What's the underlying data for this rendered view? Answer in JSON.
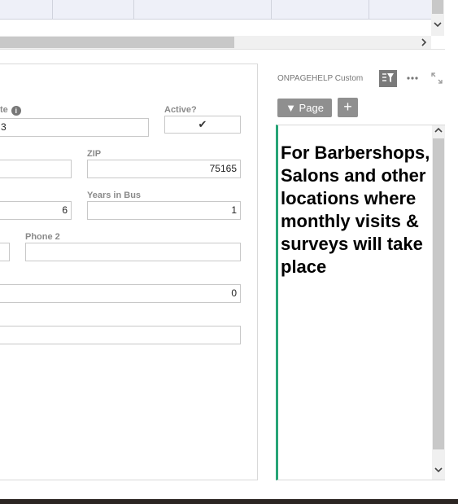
{
  "top_grid": {
    "scroll_down_icon": "chevron-down-icon",
    "scroll_right_icon": "chevron-right-icon"
  },
  "form_panel": {
    "toolbar_icons": [
      "filter-list-icon",
      "more-horizontal-icon",
      "expand-icon"
    ],
    "fields": {
      "date": {
        "label": "te",
        "value": "3"
      },
      "active": {
        "label": "Active?",
        "checked": true,
        "check_glyph": "✔"
      },
      "field_row2_left": {
        "value": ""
      },
      "zip": {
        "label": "ZIP",
        "value": "75165"
      },
      "field_row3_left": {
        "value": "6"
      },
      "years_in_bus": {
        "label": "Years in Bus",
        "value": "1"
      },
      "field_row4_left": {
        "value": ""
      },
      "phone2": {
        "label": "Phone 2",
        "value": ""
      },
      "field_row5": {
        "value": "0"
      },
      "field_row6": {
        "value": ""
      }
    },
    "info_glyph": "i"
  },
  "help_panel": {
    "title": "ONPAGEHELP Custom",
    "page_button": "▼ Page",
    "add_button": "+",
    "help_text": "For Barbershops, Salons and other locations where monthly visits & surveys will take place",
    "accent_color": "#27a577"
  }
}
